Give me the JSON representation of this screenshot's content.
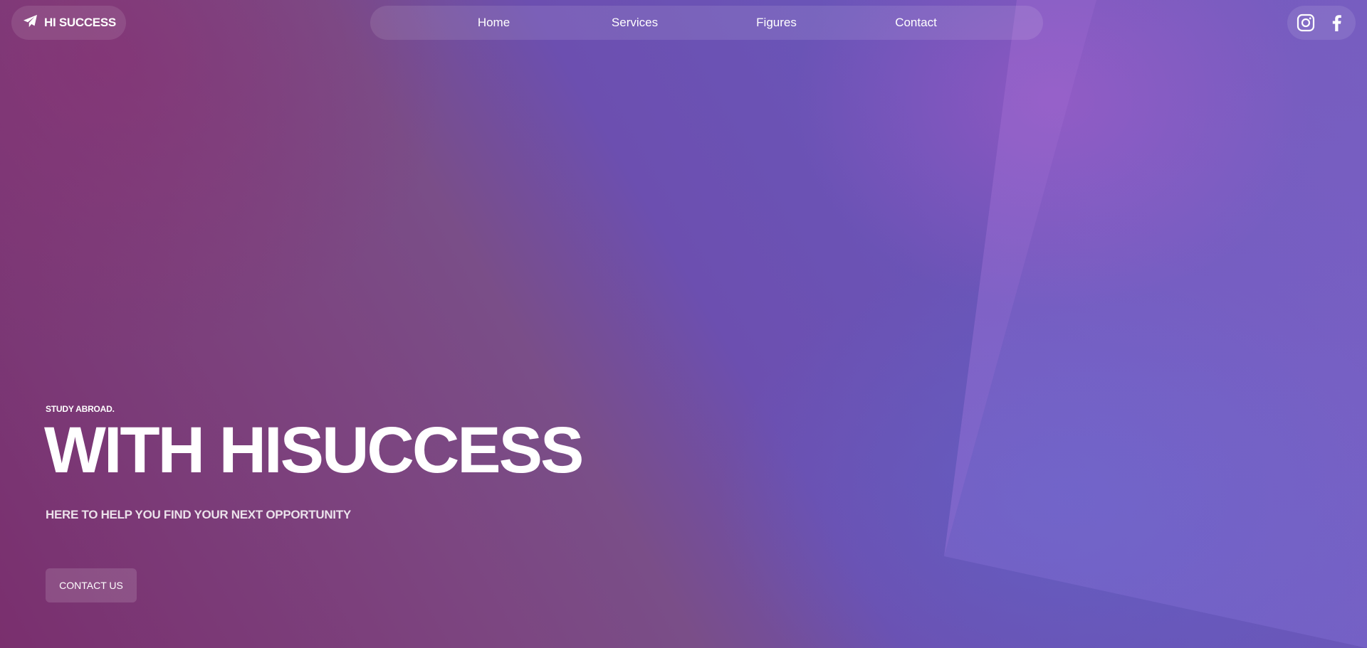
{
  "brand": {
    "name": "HI SUCCESS",
    "icon": "paper-plane-icon"
  },
  "nav": {
    "items": [
      {
        "label": "Home"
      },
      {
        "label": "Services"
      },
      {
        "label": "Figures"
      },
      {
        "label": "Contact"
      }
    ]
  },
  "social": {
    "icons": [
      "instagram-icon",
      "facebook-icon"
    ]
  },
  "hero": {
    "eyebrow": "STUDY ABROAD.",
    "headline": "WITH HISUCCESS",
    "tagline": "HERE TO HELP YOU FIND YOUR NEXT OPPORTUNITY",
    "cta_label": "CONTACT US"
  },
  "colors": {
    "accent_purple": "#6a55b8",
    "accent_magenta": "#7a2f6e",
    "text": "#ffffff"
  }
}
